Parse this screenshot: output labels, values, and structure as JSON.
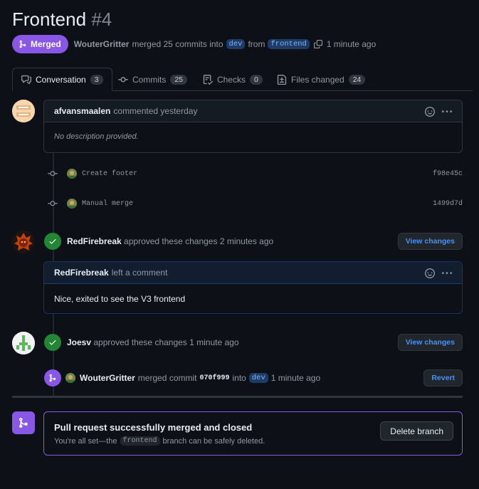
{
  "pr": {
    "title": "Frontend",
    "number": "#4",
    "state": "Merged",
    "author": "WouterGritter",
    "merge_text": "merged 25 commits into",
    "base_branch": "dev",
    "from_text": "from",
    "head_branch": "frontend",
    "time": "1 minute ago"
  },
  "tabs": [
    {
      "label": "Conversation",
      "count": "3"
    },
    {
      "label": "Commits",
      "count": "25"
    },
    {
      "label": "Checks",
      "count": "0"
    },
    {
      "label": "Files changed",
      "count": "24"
    }
  ],
  "timeline": {
    "first_comment": {
      "author": "afvansmaalen",
      "action": "commented yesterday",
      "body": "No description provided."
    },
    "commits": [
      {
        "message": "Create footer",
        "sha": "f98e45c"
      },
      {
        "message": "Manual merge",
        "sha": "1499d7d"
      }
    ],
    "review1": {
      "author": "RedFirebreak",
      "action": "approved these changes 2 minutes ago",
      "button": "View changes"
    },
    "review1_comment": {
      "author": "RedFirebreak",
      "action": "left a comment",
      "body": "Nice, exited to see the V3 frontend"
    },
    "review2": {
      "author": "Joesv",
      "action": "approved these changes 1 minute ago",
      "button": "View changes"
    },
    "merge_event": {
      "author": "WouterGritter",
      "action": "merged commit",
      "sha": "070f999",
      "into": "into",
      "branch": "dev",
      "time": "1 minute ago",
      "button": "Revert"
    }
  },
  "merge_box": {
    "title": "Pull request successfully merged and closed",
    "sub_before": "You're all set—the",
    "branch": "frontend",
    "sub_after": "branch can be safely deleted.",
    "button": "Delete branch"
  },
  "colors": {
    "merged": "#8957e5",
    "approved": "#238636",
    "link": "#4493f8",
    "background": "#0d1117"
  }
}
